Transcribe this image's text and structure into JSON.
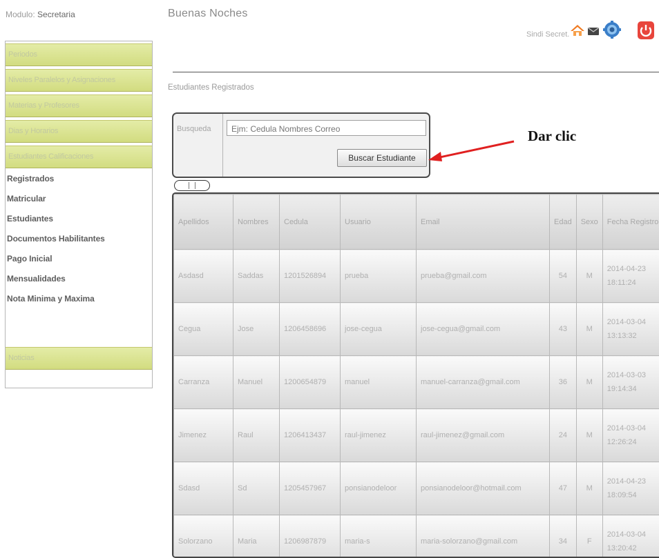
{
  "header": {
    "module_label": "Modulo:",
    "module_value": "Secretaria",
    "greeting": "Buenas Noches",
    "user_name": "Sindi Secret.",
    "icons": [
      "home-icon",
      "mail-icon",
      "settings-icon",
      "power-icon"
    ]
  },
  "section_title": "Estudiantes Registrados",
  "sidebar": {
    "buttons": [
      "Periodos",
      "Niveles Paralelos y Asignaciones",
      "Materias y Profesores",
      "Dias y Horarios",
      "Estudiantes Calificaciones",
      "Noticias"
    ],
    "sub_items": [
      "Registrados",
      "Matricular",
      "Estudiantes",
      "Documentos Habilitantes",
      "Pago Inicial",
      "Mensualidades",
      "Nota Minima y Maxima"
    ]
  },
  "search": {
    "label": "Busqueda",
    "placeholder": "Ejm: Cedula Nombres Correo",
    "button": "Buscar Estudiante"
  },
  "annotation": "Dar clic",
  "table": {
    "columns": [
      "Apellidos",
      "Nombres",
      "Cedula",
      "Usuario",
      "Email",
      "Edad",
      "Sexo",
      "Fecha Registro"
    ],
    "rows": [
      [
        "Asdasd",
        "Saddas",
        "1201526894",
        "prueba",
        "prueba@gmail.com",
        "54",
        "M",
        "2014-04-23",
        "18:11:24"
      ],
      [
        "Cegua",
        "Jose",
        "1206458696",
        "jose-cegua",
        "jose-cegua@gmail.com",
        "43",
        "M",
        "2014-03-04",
        "13:13:32"
      ],
      [
        "Carranza",
        "Manuel",
        "1200654879",
        "manuel",
        "manuel-carranza@gmail.com",
        "36",
        "M",
        "2014-03-03",
        "19:14:34"
      ],
      [
        "Jimenez",
        "Raul",
        "1206413437",
        "raul-jimenez",
        "raul-jimenez@gmail.com",
        "24",
        "M",
        "2014-03-04",
        "12:26:24"
      ],
      [
        "Sdasd",
        "Sd",
        "1205457967",
        "ponsianodeloor",
        "ponsianodeloor@hotmail.com",
        "47",
        "M",
        "2014-04-23",
        "18:09:54"
      ],
      [
        "Solorzano",
        "Maria",
        "1206987879",
        "maria-s",
        "maria-solorzano@gmail.com",
        "34",
        "F",
        "2014-03-04",
        "13:20:42"
      ]
    ]
  },
  "colors": {
    "sidebar_button": "#d8e08a",
    "arrow": "#e02020",
    "power_icon": "#e8453c",
    "home_icon": "#f07b22"
  }
}
